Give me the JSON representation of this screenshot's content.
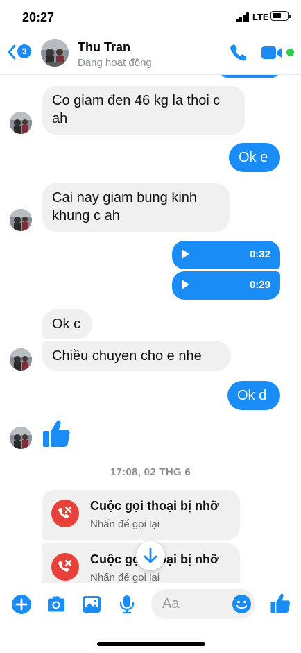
{
  "status_bar": {
    "time": "20:27",
    "network": "LTE"
  },
  "header": {
    "back_badge": "3",
    "contact_name": "Thu Tran",
    "status": "Đang hoạt động"
  },
  "colors": {
    "accent": "#1a8cf5",
    "active": "#31cc46",
    "missed": "#e8413a",
    "bubble_in": "#f0f0f0"
  },
  "messages": {
    "m1": "Co giam đen 46 kg la thoi c ah",
    "m2": "Ok e",
    "m3": "Cai nay giam bung kinh khung c ah",
    "voice1_duration": "0:32",
    "voice2_duration": "0:29",
    "m4": "Ok c",
    "m5": "Chiều chuyen cho e nhe",
    "m6": "Ok d",
    "like_icon": "thumbs-up-icon"
  },
  "timestamp": "17:08, 02 THG 6",
  "missed_calls": [
    {
      "title": "Cuộc gọi thoại bị nhỡ",
      "subtitle": "Nhấn để gọi lại"
    },
    {
      "title": "Cuộc gọi thoại bị nhỡ",
      "subtitle": "Nhấn để gọi lại"
    }
  ],
  "composer": {
    "placeholder": "Aa",
    "icons": [
      "plus-icon",
      "camera-icon",
      "gallery-icon",
      "microphone-icon",
      "emoji-icon",
      "thumbs-up-icon"
    ]
  }
}
